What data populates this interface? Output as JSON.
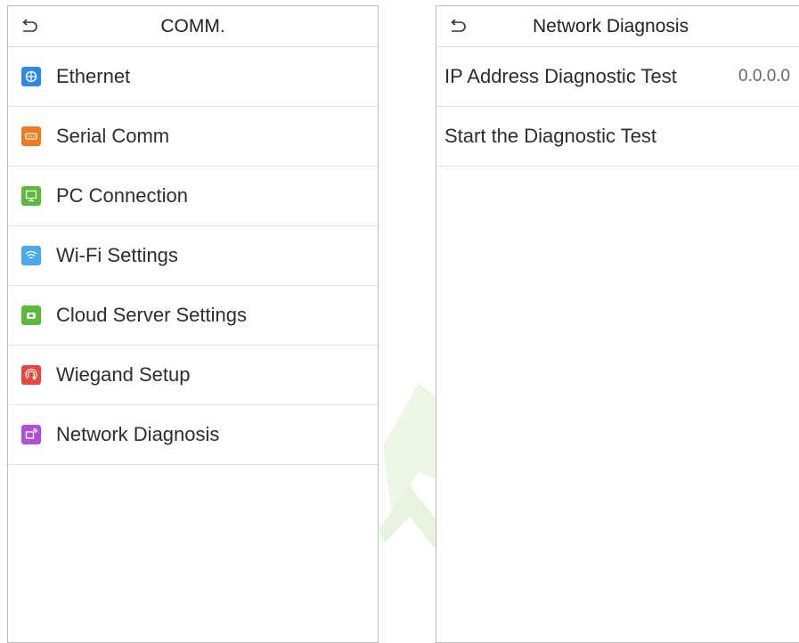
{
  "left": {
    "title": "COMM.",
    "items": [
      {
        "label": "Ethernet",
        "icon": "ethernet-icon",
        "color": "#2a8be6"
      },
      {
        "label": "Serial Comm",
        "icon": "serial-comm-icon",
        "color": "#f07a1e"
      },
      {
        "label": "PC Connection",
        "icon": "pc-connection-icon",
        "color": "#5cba3b"
      },
      {
        "label": "Wi-Fi Settings",
        "icon": "wifi-icon",
        "color": "#4aa9ee"
      },
      {
        "label": "Cloud Server Settings",
        "icon": "cloud-server-icon",
        "color": "#5cba3b"
      },
      {
        "label": "Wiegand Setup",
        "icon": "wiegand-icon",
        "color": "#e8473d"
      },
      {
        "label": "Network Diagnosis",
        "icon": "network-diagnosis-icon",
        "color": "#b14fd8"
      }
    ]
  },
  "right": {
    "title": "Network Diagnosis",
    "items": [
      {
        "label": "IP Address Diagnostic Test",
        "value": "0.0.0.0"
      },
      {
        "label": "Start the Diagnostic Test",
        "value": ""
      }
    ]
  }
}
